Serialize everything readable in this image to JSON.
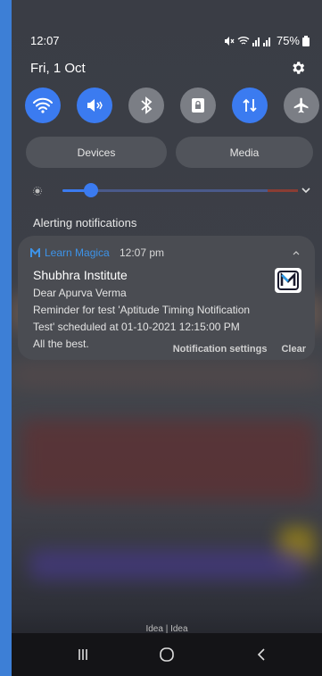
{
  "status_bar": {
    "time": "12:07",
    "battery": "75%"
  },
  "date": "Fri, 1 Oct",
  "quick_settings": [
    {
      "name": "wifi",
      "on": true
    },
    {
      "name": "mute",
      "on": true
    },
    {
      "name": "bluetooth",
      "on": false
    },
    {
      "name": "screen-rotation-lock",
      "on": false
    },
    {
      "name": "mobile-data",
      "on": true
    },
    {
      "name": "airplane-mode",
      "on": false
    }
  ],
  "panel_buttons": {
    "devices": "Devices",
    "media": "Media"
  },
  "brightness": 0.12,
  "alerting_title": "Alerting notifications",
  "notification": {
    "app_name": "Learn Magica",
    "time": "12:07 pm",
    "title": "Shubhra Institute",
    "lines": [
      "Dear Apurva Verma",
      "Reminder for test 'Aptitude Timing Notification",
      "Test' scheduled at 01-10-2021 12:15:00 PM",
      "All the best."
    ]
  },
  "actions": {
    "settings": "Notification settings",
    "clear": "Clear"
  },
  "carrier": "Idea | Idea",
  "colors": {
    "accent": "#3b7bf0",
    "app_name": "#3d93e8",
    "card": "#4a4c52"
  }
}
